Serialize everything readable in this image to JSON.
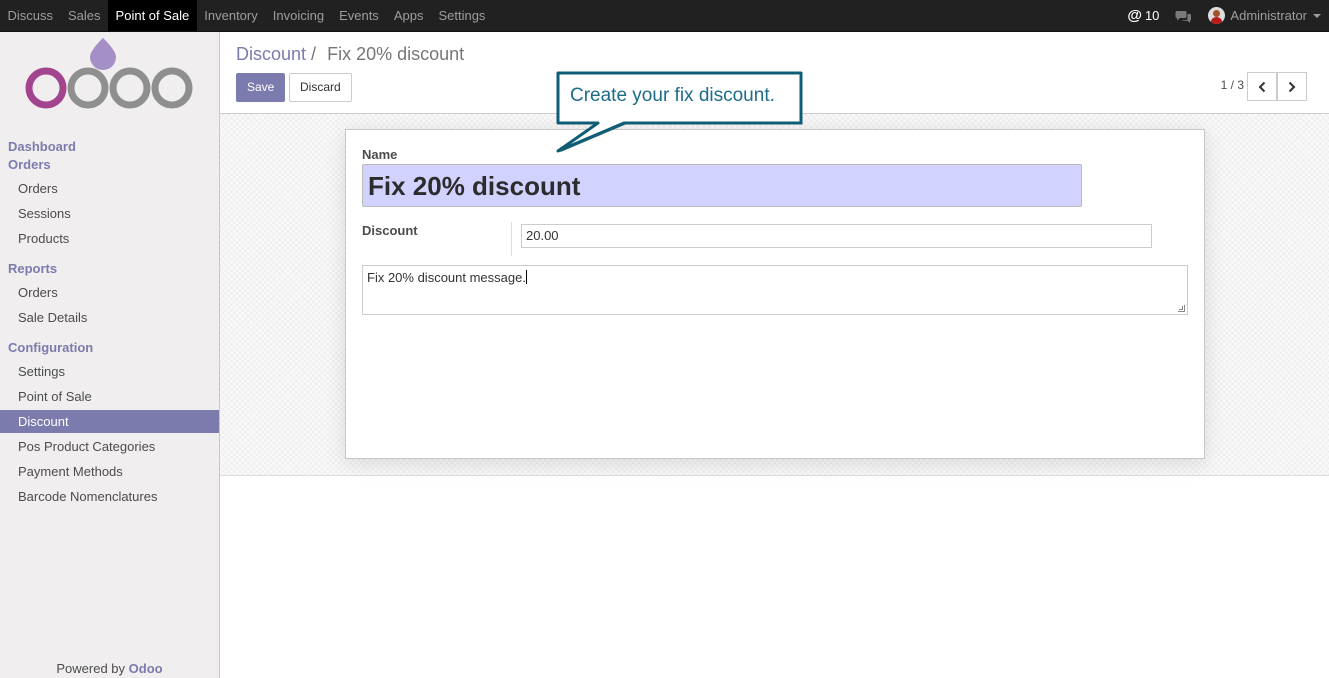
{
  "topnav": {
    "apps": [
      {
        "label": "Discuss"
      },
      {
        "label": "Sales"
      },
      {
        "label": "Point of Sale"
      },
      {
        "label": "Inventory"
      },
      {
        "label": "Invoicing"
      },
      {
        "label": "Events"
      },
      {
        "label": "Apps"
      },
      {
        "label": "Settings"
      }
    ],
    "active_app": "Point of Sale",
    "mentions_count": "10",
    "user_name": "Administrator"
  },
  "sidebar": {
    "logo_text": "odoo",
    "sections": {
      "dashboard": "Dashboard",
      "orders": "Orders",
      "reports": "Reports",
      "configuration": "Configuration"
    },
    "orders_items": [
      "Orders",
      "Sessions",
      "Products"
    ],
    "reports_items": [
      "Orders",
      "Sale Details"
    ],
    "config_items": [
      "Settings",
      "Point of Sale",
      "Discount",
      "Pos Product Categories",
      "Payment Methods",
      "Barcode Nomenclatures"
    ],
    "active_item": "Discount",
    "powered_by": "Powered by",
    "powered_brand": "Odoo"
  },
  "control_panel": {
    "breadcrumb_parent": "Discount",
    "breadcrumb_separator": "/",
    "breadcrumb_current": "Fix 20% discount",
    "save_label": "Save",
    "discard_label": "Discard",
    "pager": "1 / 3"
  },
  "form": {
    "name_label": "Name",
    "name_value": "Fix 20% discount",
    "discount_label": "Discount",
    "discount_value": "20.00",
    "message_value": "Fix 20% discount message."
  },
  "tooltip": {
    "text": "Create your fix discount."
  },
  "colors": {
    "brand": "#7c7bad",
    "topbar": "#212121",
    "name_highlight": "#d2d2ff",
    "tooltip_text": "#1d6c8a"
  },
  "icons": [
    "at-icon",
    "chat-icon",
    "avatar",
    "chevron-left-icon",
    "chevron-right-icon",
    "resize-handle-icon"
  ]
}
